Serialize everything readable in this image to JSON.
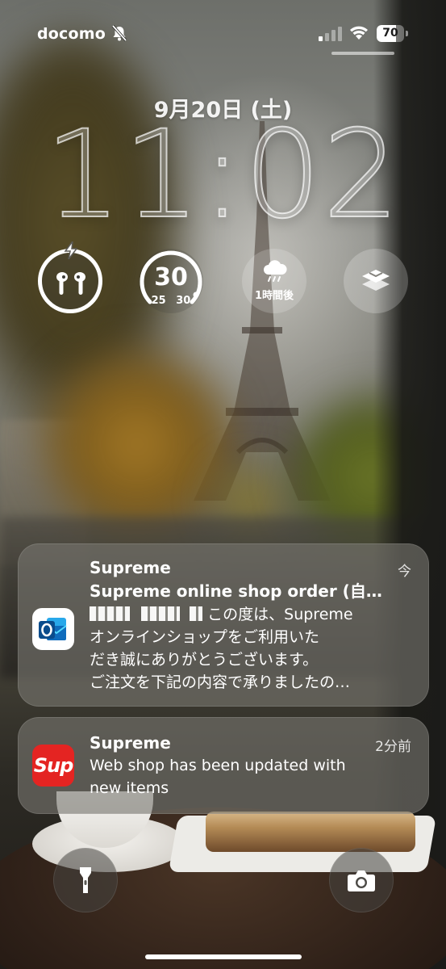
{
  "status_bar": {
    "carrier": "docomo",
    "battery_percent": "70",
    "battery_level": 0.7,
    "icons": [
      "bell-slash-icon",
      "cellular-signal-icon",
      "wifi-icon",
      "battery-icon"
    ]
  },
  "lock_screen": {
    "date": "9月20日 (土)",
    "time": "11:02"
  },
  "widgets": {
    "airpods": {
      "icon": "airpods-charging-icon"
    },
    "temperature": {
      "current": "30",
      "range": "25 30"
    },
    "rain": {
      "icon": "rain-cloud-icon",
      "label": "1時間後"
    },
    "shortcut": {
      "icon": "shortcuts-icon"
    }
  },
  "notifications": [
    {
      "app_icon": "outlook-icon",
      "title": "Supreme",
      "time": "今",
      "subtitle": "Supreme online shop order (自…",
      "body_lines": [
        "この度は、Supreme",
        "オンラインショップをご利用いた",
        "だき誠にありがとうございます。",
        "ご注文を下記の内容で承りましたの…"
      ]
    },
    {
      "app_icon": "supreme-icon",
      "app_icon_text": "Sup",
      "title": "Supreme",
      "time": "2分前",
      "body_lines": [
        "Web shop has been updated with",
        "new items"
      ]
    }
  ],
  "quick_actions": {
    "left": "flashlight-icon",
    "right": "camera-icon"
  },
  "colors": {
    "supreme_red": "#e42422",
    "outlook_blue": "#0f6cbd"
  }
}
